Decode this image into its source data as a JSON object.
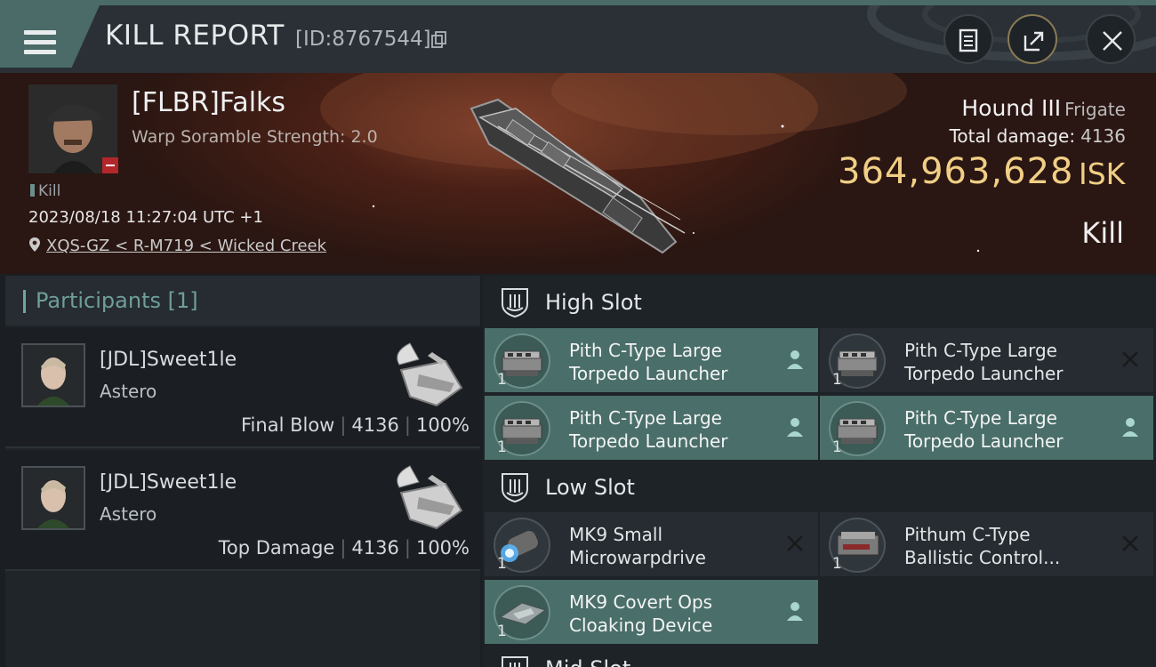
{
  "header": {
    "title": "KILL REPORT",
    "report_id": "[ID:8767544]"
  },
  "victim": {
    "name": "[FLBR]Falks",
    "warp_scramble": "Warp Soramble Strength: 2.0",
    "tag": "Kill",
    "timestamp": "2023/08/18 11:27:04 UTC +1",
    "location": "XQS-GZ < R-M719 < Wicked Creek",
    "ship_name": "Hound III",
    "ship_class": "Frigate",
    "total_damage_label": "Total damage:",
    "total_damage_value": "4136",
    "isk_value": "364,963,628",
    "isk_unit": "ISK",
    "result": "Kill"
  },
  "participants": {
    "title": "Participants [1]",
    "items": [
      {
        "name": "[JDL]Sweet1le",
        "ship": "Astero",
        "role": "Final Blow",
        "damage": "4136",
        "percent": "100%"
      },
      {
        "name": "[JDL]Sweet1le",
        "ship": "Astero",
        "role": "Top Damage",
        "damage": "4136",
        "percent": "100%"
      }
    ]
  },
  "slots": {
    "high": {
      "label": "High Slot",
      "modules": [
        {
          "line1": "Pith C-Type Large",
          "line2": "Torpedo Launcher",
          "qty": "1",
          "status": "dropped"
        },
        {
          "line1": "Pith C-Type Large",
          "line2": "Torpedo Launcher",
          "qty": "1",
          "status": "destroyed"
        },
        {
          "line1": "Pith C-Type Large",
          "line2": "Torpedo Launcher",
          "qty": "1",
          "status": "dropped"
        },
        {
          "line1": "Pith C-Type Large",
          "line2": "Torpedo Launcher",
          "qty": "1",
          "status": "dropped"
        }
      ]
    },
    "low": {
      "label": "Low Slot",
      "modules": [
        {
          "line1": "MK9 Small",
          "line2": "Microwarpdrive",
          "qty": "1",
          "status": "destroyed"
        },
        {
          "line1": "Pithum C-Type",
          "line2": "Ballistic Control...",
          "qty": "1",
          "status": "destroyed"
        },
        {
          "line1": "MK9 Covert Ops",
          "line2": "Cloaking Device",
          "qty": "1",
          "status": "dropped"
        }
      ]
    },
    "mid": {
      "label": "Mid Slot"
    }
  },
  "colors": {
    "accent_teal": "#4a6e69",
    "isk_gold": "#f0cf85",
    "background": "#1b1f24"
  },
  "icons": [
    "menu-icon",
    "copy-icon",
    "report-icon",
    "share-icon",
    "close-icon",
    "location-pin-icon",
    "person-icon",
    "x-icon",
    "shield-slot-icon"
  ]
}
